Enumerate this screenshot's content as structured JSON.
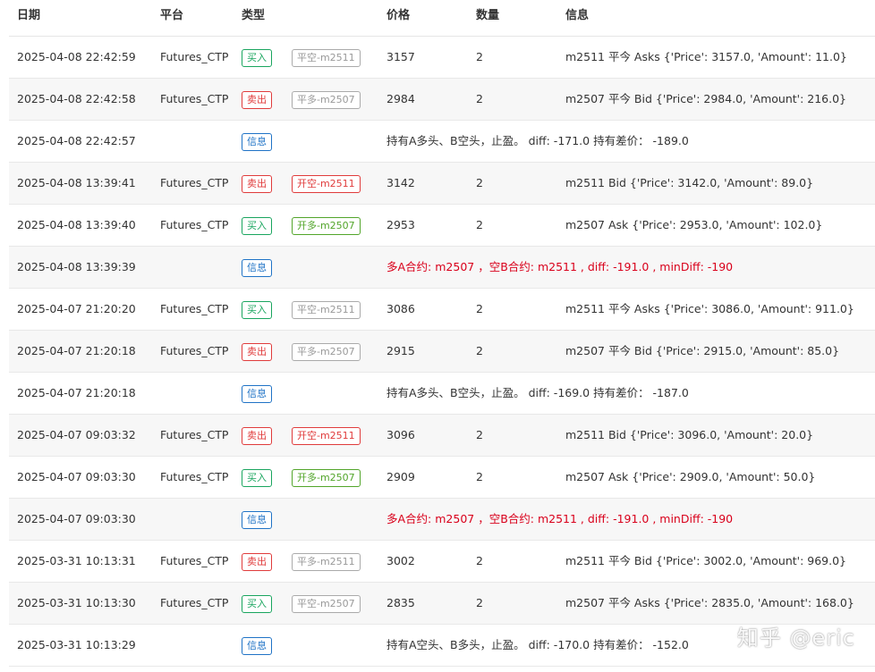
{
  "header": {
    "date": "日期",
    "platform": "平台",
    "type": "类型",
    "price": "价格",
    "qty": "数量",
    "info": "信息"
  },
  "colors": {
    "buy": "#19a55e",
    "sell": "#e03b3b",
    "info": "#1f73c6",
    "message_red": "#d9001b",
    "closed": "#999999"
  },
  "rows": [
    {
      "date": "2025-04-08 22:42:59",
      "platform": "Futures_CTP",
      "type": "买入",
      "op": "平空-m2511",
      "price": "3157",
      "qty": "2",
      "info": "m2511 平今 Asks {'Price': 3157.0, 'Amount': 11.0}"
    },
    {
      "date": "2025-04-08 22:42:58",
      "platform": "Futures_CTP",
      "type": "卖出",
      "op": "平多-m2507",
      "price": "2984",
      "qty": "2",
      "info": "m2507 平今 Bid {'Price': 2984.0, 'Amount': 216.0}"
    },
    {
      "date": "2025-04-08 22:42:57",
      "type": "信息",
      "message": "持有A多头、B空头，止盈。 diff: -171.0 持有差价： -189.0"
    },
    {
      "date": "2025-04-08 13:39:41",
      "platform": "Futures_CTP",
      "type": "卖出",
      "op": "开空-m2511",
      "price": "3142",
      "qty": "2",
      "info": "m2511 Bid {'Price': 3142.0, 'Amount': 89.0}"
    },
    {
      "date": "2025-04-08 13:39:40",
      "platform": "Futures_CTP",
      "type": "买入",
      "op": "开多-m2507",
      "price": "2953",
      "qty": "2",
      "info": "m2507 Ask {'Price': 2953.0, 'Amount': 102.0}"
    },
    {
      "date": "2025-04-08 13:39:39",
      "type": "信息",
      "message": "多A合约: m2507 ，空B合约: m2511 , diff: -191.0 , minDiff: -190"
    },
    {
      "date": "2025-04-07 21:20:20",
      "platform": "Futures_CTP",
      "type": "买入",
      "op": "平空-m2511",
      "price": "3086",
      "qty": "2",
      "info": "m2511 平今 Asks {'Price': 3086.0, 'Amount': 911.0}"
    },
    {
      "date": "2025-04-07 21:20:18",
      "platform": "Futures_CTP",
      "type": "卖出",
      "op": "平多-m2507",
      "price": "2915",
      "qty": "2",
      "info": "m2507 平今 Bid {'Price': 2915.0, 'Amount': 85.0}"
    },
    {
      "date": "2025-04-07 21:20:18",
      "type": "信息",
      "message": "持有A多头、B空头，止盈。 diff: -169.0 持有差价： -187.0"
    },
    {
      "date": "2025-04-07 09:03:32",
      "platform": "Futures_CTP",
      "type": "卖出",
      "op": "开空-m2511",
      "price": "3096",
      "qty": "2",
      "info": "m2511 Bid {'Price': 3096.0, 'Amount': 20.0}"
    },
    {
      "date": "2025-04-07 09:03:30",
      "platform": "Futures_CTP",
      "type": "买入",
      "op": "开多-m2507",
      "price": "2909",
      "qty": "2",
      "info": "m2507 Ask {'Price': 2909.0, 'Amount': 50.0}"
    },
    {
      "date": "2025-04-07 09:03:30",
      "type": "信息",
      "message": "多A合约: m2507 ，空B合约: m2511 , diff: -191.0 , minDiff: -190"
    },
    {
      "date": "2025-03-31 10:13:31",
      "platform": "Futures_CTP",
      "type": "卖出",
      "op": "平多-m2511",
      "price": "3002",
      "qty": "2",
      "info": "m2511 平今 Bid {'Price': 3002.0, 'Amount': 969.0}"
    },
    {
      "date": "2025-03-31 10:13:30",
      "platform": "Futures_CTP",
      "type": "买入",
      "op": "平空-m2507",
      "price": "2835",
      "qty": "2",
      "info": "m2507 平今 Asks {'Price': 2835.0, 'Amount': 168.0}"
    },
    {
      "date": "2025-03-31 10:13:29",
      "type": "信息",
      "message": "持有A空头、B多头，止盈。 diff: -170.0 持有差价： -152.0"
    }
  ],
  "watermark": "知乎 @eric"
}
